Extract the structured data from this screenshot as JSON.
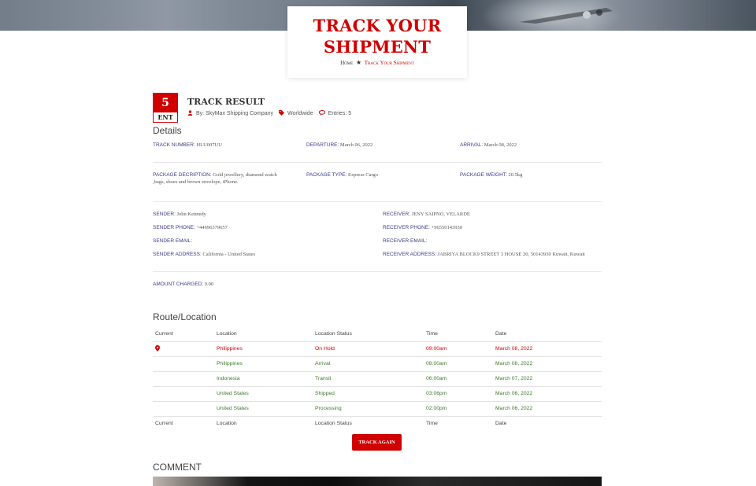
{
  "hero": {
    "title_line1": "TRACK YOUR",
    "title_line2": "SHIPMENT",
    "breadcrumb_home": "Home",
    "breadcrumb_current": "Track Your Shipment"
  },
  "result": {
    "badge_number": "5",
    "badge_unit": "ENT",
    "title": "TRACK RESULT",
    "meta_author": "By: SkyMax Shipping Company",
    "meta_category": "Worldwide",
    "meta_entries": "Entries: 5"
  },
  "details": {
    "heading": "Details",
    "track_number": {
      "label": "TRACK NUMBER:",
      "value": "HLU007UU"
    },
    "departure": {
      "label": "DEPARTURE:",
      "value": "March 06, 2022"
    },
    "arrival": {
      "label": "ARRIVAL:",
      "value": "March 08, 2022"
    },
    "package_description": {
      "label": "PACKAGE DECRIPTION:",
      "value_line1": "Gold jewellery, diamond watch",
      "value_line2": ",bags, shoes and brown envelope, iPhone."
    },
    "package_type": {
      "label": "PACKAGE TYPE:",
      "value": "Express Cargo"
    },
    "package_weight": {
      "label": "PACKAGE WEIGHT:",
      "value": "20.5kg"
    },
    "sender": {
      "label": "SENDER:",
      "value": "John Kennedy"
    },
    "sender_phone": {
      "label": "SENDER PHONE:",
      "value": "+44696379657"
    },
    "sender_email": {
      "label": "SENDER EMAIL:",
      "value": ""
    },
    "sender_address": {
      "label": "SENDER ADDRESS:",
      "value": "California - United States"
    },
    "receiver": {
      "label": "RECEIVER:",
      "value": "JENY SAIPNO, VELARDE"
    },
    "receiver_phone": {
      "label": "RECEIVER PHONE:",
      "value": "+96550143930"
    },
    "receiver_email": {
      "label": "RECEIVER EMAIL:",
      "value": ""
    },
    "receiver_address": {
      "label": "RECEIVER ADDRESS:",
      "value": "JABRIYA BLOCK9 STREET 3 HOUSE 20, 50143930 Kuwait, Kuwait"
    },
    "amount_charged": {
      "label": "AMOUNT CHARGED:",
      "value": "0.00"
    }
  },
  "route": {
    "heading": "Route/Location",
    "columns": [
      "Current",
      "Location",
      "Location Status",
      "Time",
      "Date"
    ],
    "rows": [
      {
        "location": "Philippines",
        "status": "On Hold",
        "time": "09:00am",
        "date": "March 08, 2022",
        "current": true
      },
      {
        "location": "Philippines",
        "status": "Arrival",
        "time": "08:00am",
        "date": "March 08, 2022",
        "current": false
      },
      {
        "location": "Indonesia",
        "status": "Transit",
        "time": "06:00am",
        "date": "March 07, 2022",
        "current": false
      },
      {
        "location": "United States",
        "status": "Shipped",
        "time": "03:06pm",
        "date": "March 06, 2022",
        "current": false
      },
      {
        "location": "United States",
        "status": "Processing",
        "time": "02:00pm",
        "date": "March 06, 2022",
        "current": false
      }
    ]
  },
  "actions": {
    "track_again": "TRACK AGAIN"
  },
  "comment": {
    "heading": "COMMENT"
  },
  "colors": {
    "accent": "#d10000",
    "label_blue": "#3a3a88",
    "status_green": "#3e7a2a"
  },
  "icons": {
    "author": "user-icon",
    "category": "tag-icon",
    "entries": "comments-icon",
    "current": "map-marker-icon",
    "breadcrumb_sep": "star-icon"
  }
}
